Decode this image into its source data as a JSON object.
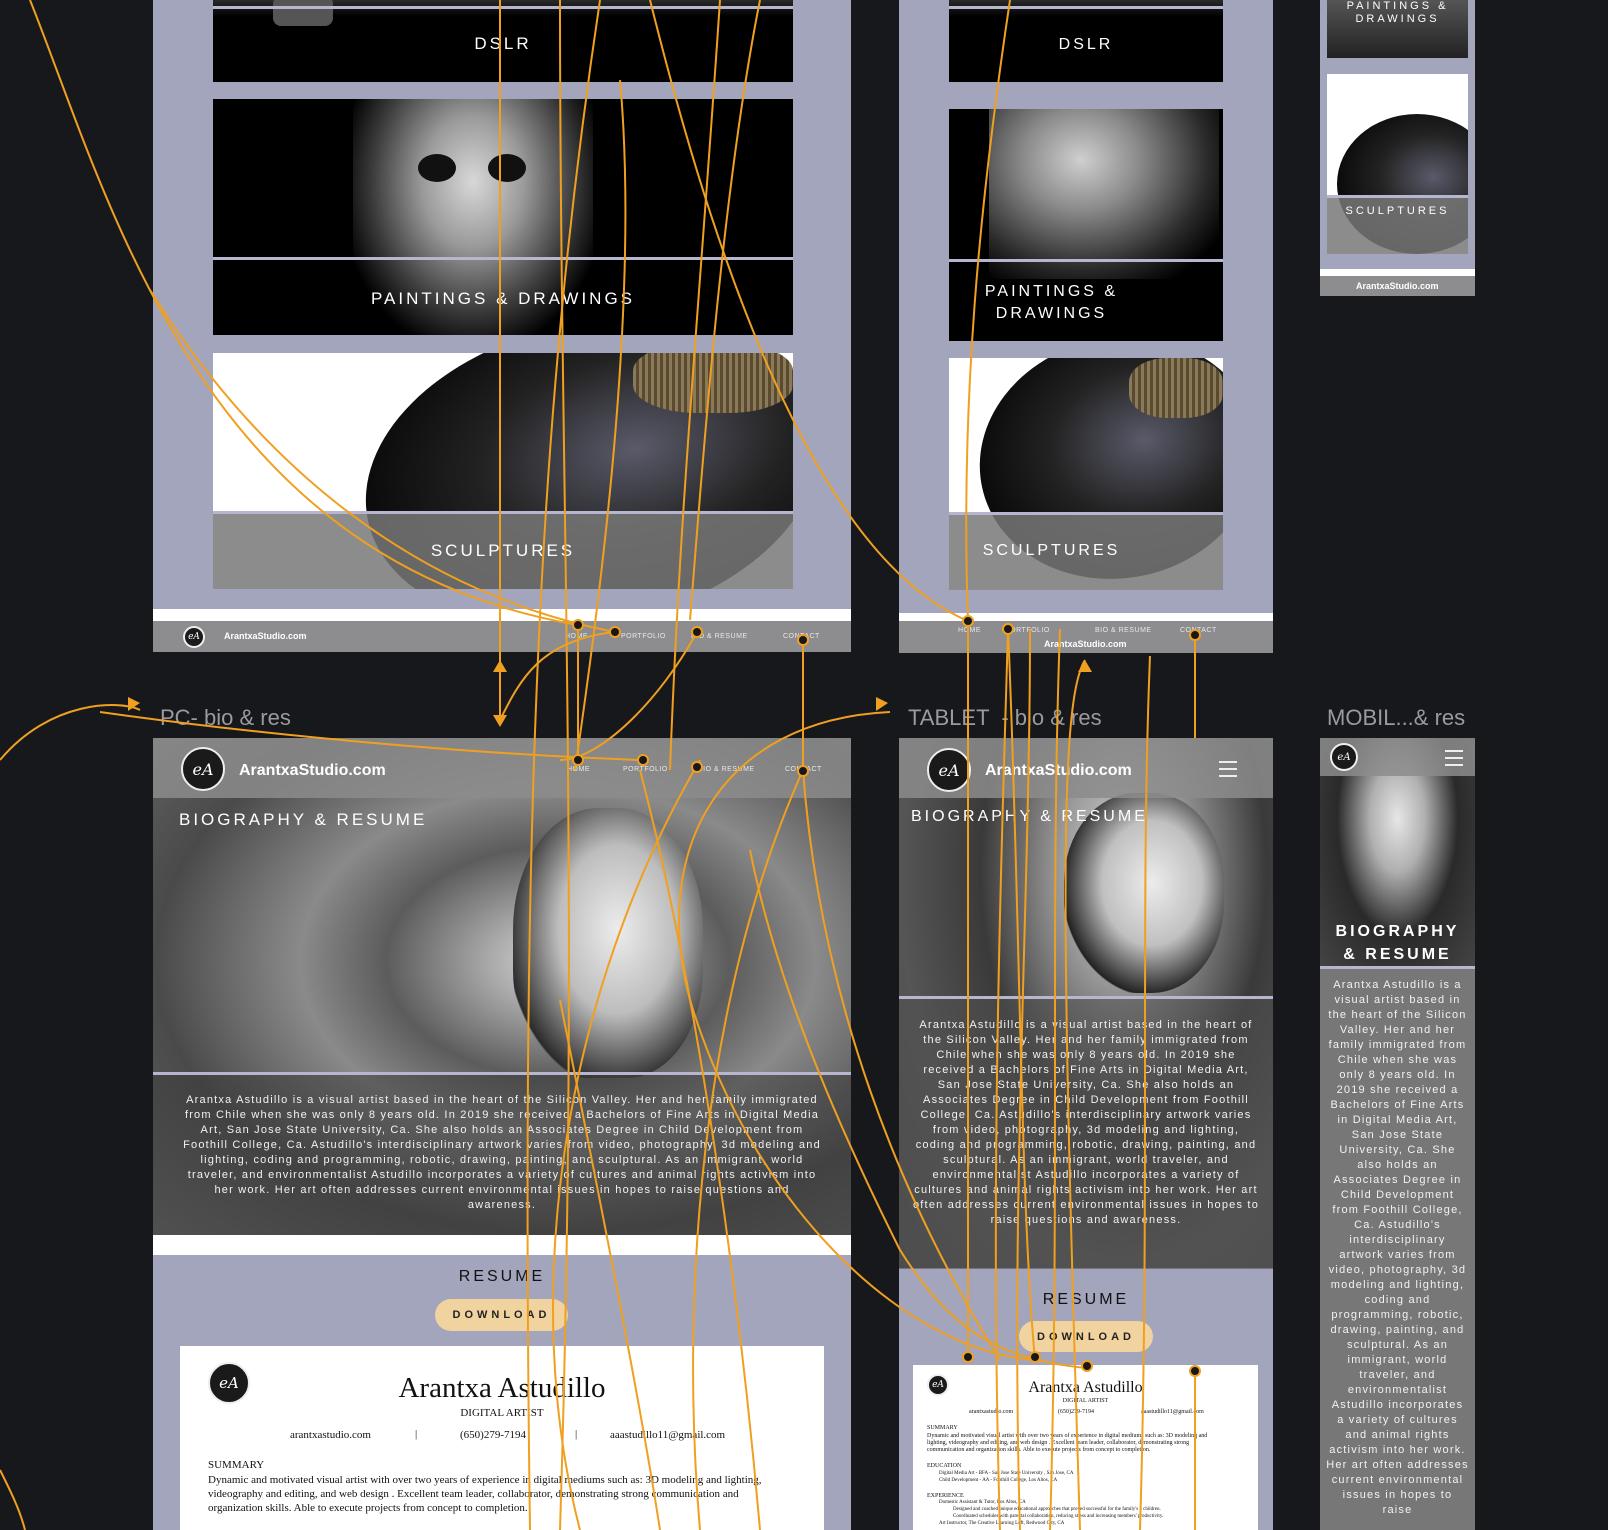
{
  "pc_frame": {
    "card_labels": [
      "DSLR",
      "PAINTINGS & DRAWINGS",
      "SCULPTURES"
    ],
    "footer_site": "ArantxaStudio.com",
    "nav": [
      "HOME",
      "PORTFOLIO",
      "BIO & RESUME",
      "CONTACT"
    ]
  },
  "tablet_frame": {
    "card_labels": [
      "DSLR",
      "PAINTINGS &\nDRAWINGS",
      "SCULPTURES"
    ],
    "footer_site": "ArantxaStudio.com",
    "nav": [
      "HOME",
      "PORTFOLIO",
      "BIO & RESUME",
      "CONTACT"
    ]
  },
  "mobile_frame": {
    "card_labels": [
      "PAINTINGS &\nDRAWINGS",
      "SCULPTURES"
    ],
    "footer_site": "ArantxaStudio.com"
  },
  "titles": {
    "pc": "PC- bio & res",
    "tablet": "TABLET  - bio & res",
    "mobile": "MOBIL...& res"
  },
  "pc_bio": {
    "site": "ArantxaStudio.com",
    "nav": [
      "HOME",
      "PORTFOLIO",
      "BIO & RESUME",
      "CONTACT"
    ],
    "heading": "BIOGRAPHY & RESUME",
    "bio": "Arantxa Astudillo is a visual artist based in the heart of the Silicon Valley. Her and her family immigrated from Chile when she was only 8 years old. In 2019 she received a Bachelors of Fine Arts in Digital Media Art, San Jose State University, Ca. She also holds an Associates Degree in Child Development from Foothill College, Ca. Astudillo's interdisciplinary artwork varies from video, photography, 3d modeling and lighting, coding and programming, robotic, drawing, painting, and sculptural. As an immigrant, world traveler, and environmentalist Astudillo incorporates a variety of cultures and animal rights activism into her work. Her art often addresses current environmental issues in hopes to raise questions and awareness.",
    "resume_heading": "RESUME",
    "download": "DOWNLOAD",
    "resume": {
      "name": "Arantxa Astudillo",
      "role": "DIGITAL ARTIST",
      "website": "arantxastudio.com",
      "phone": "(650)279-7194",
      "email": "aaastudillo11@gmail.com",
      "summary_heading": "SUMMARY",
      "summary": "Dynamic and motivated visual artist with over two years of experience in digital mediums such as: 3D modeling and lighting, videography and editing, and web design . Excellent team leader, collaborator, demonstrating strong communication and organization skills. Able to execute projects from concept to completion."
    }
  },
  "tablet_bio": {
    "site": "ArantxaStudio.com",
    "heading": "BIOGRAPHY & RESUME",
    "bio": "Arantxa Astudillo is a visual artist based in the heart of the Silicon Valley. Her and her family immigrated from Chile when she was only 8 years old. In 2019 she received a Bachelors of Fine Arts in Digital Media Art, San Jose State University, Ca. She also holds an Associates Degree in Child Development from Foothill College, Ca. Astudillo's interdisciplinary artwork varies from video, photography, 3d modeling and lighting, coding and programming, robotic, drawing, painting, and sculptural. As an immigrant, world traveler, and environmentalist Astudillo incorporates a variety of cultures and animal rights activism into her work. Her art often addresses current environmental issues in hopes to raise questions and awareness.",
    "resume_heading": "RESUME",
    "download": "DOWNLOAD",
    "resume": {
      "name": "Arantxa Astudillo",
      "role": "DIGITAL ARTIST",
      "website": "arantxastudio.com",
      "phone": "(650)279-7194",
      "email": "aaastudillo11@gmail.com",
      "summary_heading": "SUMMARY",
      "summary": "Dynamic and motivated visual artist with over two years of experience in digital mediums such as: 3D modeling and lighting, videography and editing, and web design . Excellent team leader, collaborator, demonstrating strong communication and organization skills. Able to execute projects from concept to completion.",
      "education_heading": "EDUCATION",
      "education": [
        "Digital Media Art - BFA - San Jose State University , San Jose, CA",
        "Child Development - AA - Foothill College, Los Altos, CA"
      ],
      "experience_heading": "EXPERIENCE",
      "experience": [
        "Domestic Assistant & Tutor, Los Altos, CA",
        "Designed and coached unique educational approaches that proved successful for the family's 3 children.",
        "Coordinated schedules with parental collaboration, reducing stress and increasing members' productivity.",
        "Art Instructor, The Creative Learning Loft, Redwood City, CA"
      ]
    }
  },
  "mobile_bio": {
    "heading": "BIOGRAPHY\n& RESUME",
    "bio": "Arantxa Astudillo is a visual artist based in the heart of the Silicon Valley. Her and her family immigrated from Chile when she was only 8 years old. In 2019 she received a Bachelors of Fine Arts in Digital Media Art, San Jose State University, Ca. She also holds an Associates Degree in Child Development from Foothill College, Ca. Astudillo's interdisciplinary artwork varies from video, photography, 3d modeling and lighting, coding and programming, robotic, drawing, painting, and sculptural. As an immigrant, world traveler, and environmentalist Astudillo incorporates a variety of cultures and animal rights activism into her work. Her art often addresses current environmental issues in hopes to raise"
  },
  "colors": {
    "canvas": "#17181b",
    "frame_bg": "#a3a5bc",
    "footer": "#8d8d8f",
    "wire": "#f0a020",
    "button": "#f1d39f"
  }
}
